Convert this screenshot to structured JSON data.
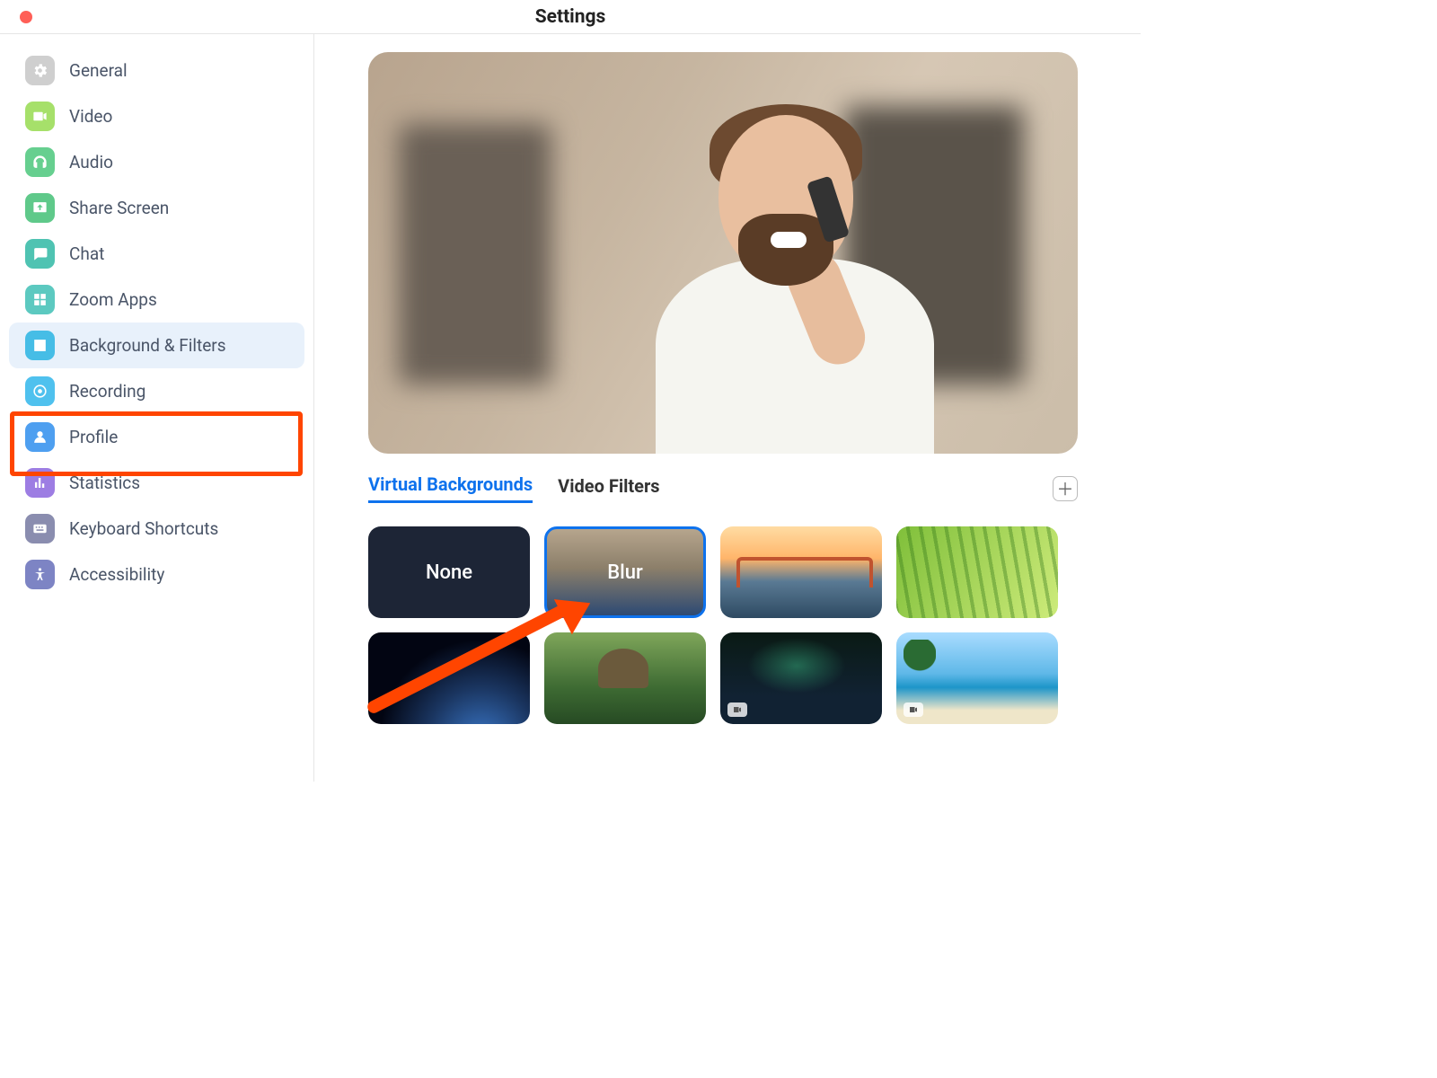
{
  "window": {
    "title": "Settings"
  },
  "sidebar": {
    "items": [
      {
        "id": "general",
        "label": "General",
        "icon": "gear-icon",
        "color": "#cfcfcf"
      },
      {
        "id": "video",
        "label": "Video",
        "icon": "video-icon",
        "color": "#a6e06a"
      },
      {
        "id": "audio",
        "label": "Audio",
        "icon": "headphones-icon",
        "color": "#66cf8f"
      },
      {
        "id": "share-screen",
        "label": "Share Screen",
        "icon": "share-screen-icon",
        "color": "#5fc98a"
      },
      {
        "id": "chat",
        "label": "Chat",
        "icon": "chat-icon",
        "color": "#4fc3b2"
      },
      {
        "id": "zoom-apps",
        "label": "Zoom Apps",
        "icon": "apps-icon",
        "color": "#5cc9c0"
      },
      {
        "id": "background-filters",
        "label": "Background & Filters",
        "icon": "background-icon",
        "color": "#46bde6",
        "active": true
      },
      {
        "id": "recording",
        "label": "Recording",
        "icon": "record-icon",
        "color": "#4fc1ee"
      },
      {
        "id": "profile",
        "label": "Profile",
        "icon": "profile-icon",
        "color": "#4e9ff0"
      },
      {
        "id": "statistics",
        "label": "Statistics",
        "icon": "statistics-icon",
        "color": "#9d7de3"
      },
      {
        "id": "keyboard-shortcuts",
        "label": "Keyboard Shortcuts",
        "icon": "keyboard-icon",
        "color": "#8a8daf"
      },
      {
        "id": "accessibility",
        "label": "Accessibility",
        "icon": "accessibility-icon",
        "color": "#7d84c4"
      }
    ]
  },
  "tabs": {
    "items": [
      {
        "id": "virtual-backgrounds",
        "label": "Virtual Backgrounds",
        "active": true
      },
      {
        "id": "video-filters",
        "label": "Video Filters",
        "active": false
      }
    ],
    "add_tooltip": "Add Image or Video"
  },
  "backgrounds": {
    "items": [
      {
        "id": "none",
        "label": "None",
        "selected": false
      },
      {
        "id": "blur",
        "label": "Blur",
        "selected": true
      },
      {
        "id": "golden-gate",
        "label": "",
        "selected": false
      },
      {
        "id": "grass",
        "label": "",
        "selected": false
      },
      {
        "id": "earth",
        "label": "",
        "selected": false
      },
      {
        "id": "jurassic",
        "label": "",
        "selected": false
      },
      {
        "id": "aurora",
        "label": "",
        "selected": false,
        "is_video": true
      },
      {
        "id": "beach",
        "label": "",
        "selected": false,
        "is_video": true
      }
    ]
  },
  "annotation": {
    "highlight_target": "background-filters",
    "arrow_target": "blur"
  }
}
